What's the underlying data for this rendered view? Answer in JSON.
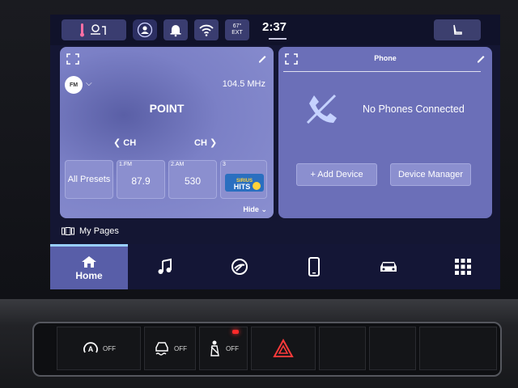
{
  "status_bar": {
    "temp_top": "67°",
    "temp_bottom": "EXT",
    "clock": "2:37"
  },
  "radio": {
    "band": "FM",
    "frequency": "104.5 MHz",
    "station": "POINT",
    "ch_prev": "CH",
    "ch_next": "CH",
    "presets": [
      {
        "label": "All Presets"
      },
      {
        "tag": "1.FM",
        "value": "87.9"
      },
      {
        "tag": "2.AM",
        "value": "530"
      },
      {
        "tag": "3",
        "logo": "SiriusXM HITS"
      }
    ],
    "hide_label": "Hide"
  },
  "phone": {
    "title": "Phone",
    "status": "No Phones Connected",
    "add_device": "+ Add Device",
    "device_manager": "Device Manager"
  },
  "my_pages": "My Pages",
  "nav": {
    "home_label": "Home",
    "items": [
      "home-icon",
      "music-icon",
      "apps-icon",
      "phone-icon",
      "car-icon",
      "grid-icon"
    ]
  },
  "hardware": {
    "btn1": "OFF",
    "btn2": "OFF",
    "btn3": "OFF"
  },
  "colors": {
    "accent": "#9ad0ff",
    "card": "#6b6fb8",
    "led": "#ff2a2a"
  }
}
